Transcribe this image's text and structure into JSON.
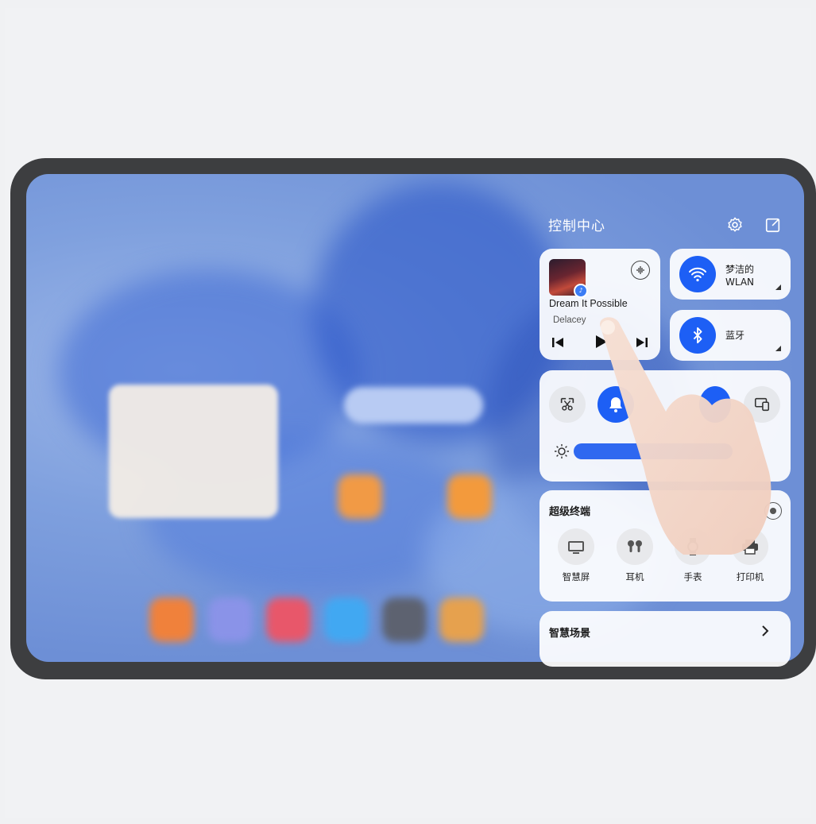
{
  "control_center": {
    "title": "控制中心",
    "settings_icon": "gear-icon",
    "edit_icon": "edit-icon"
  },
  "music": {
    "title": "Dream It Possible",
    "artist": "Delacey",
    "controls": [
      "previous-icon",
      "play-icon",
      "next-icon"
    ],
    "output_icon": "audio-output-icon"
  },
  "wifi": {
    "name": "梦洁的",
    "sub": "WLAN",
    "icon": "wifi-icon",
    "color": "#1d5ff5"
  },
  "bluetooth": {
    "label": "蓝牙",
    "icon": "bluetooth-icon",
    "color": "#1d5ff5"
  },
  "toggles": {
    "items": [
      "screenshot-icon",
      "bell-icon",
      "multiscreen-icon"
    ],
    "brightness_icon": "sun-icon"
  },
  "super_terminal": {
    "title": "超级终端",
    "devices": [
      {
        "label": "智慧屏",
        "icon": "tv-icon"
      },
      {
        "label": "耳机",
        "icon": "earbuds-icon"
      },
      {
        "label": "手表",
        "icon": "watch-icon"
      },
      {
        "label": "打印机",
        "icon": "printer-icon"
      }
    ]
  },
  "smart_scene": {
    "title": "智慧场景",
    "arrow": "chevron-right-icon"
  }
}
